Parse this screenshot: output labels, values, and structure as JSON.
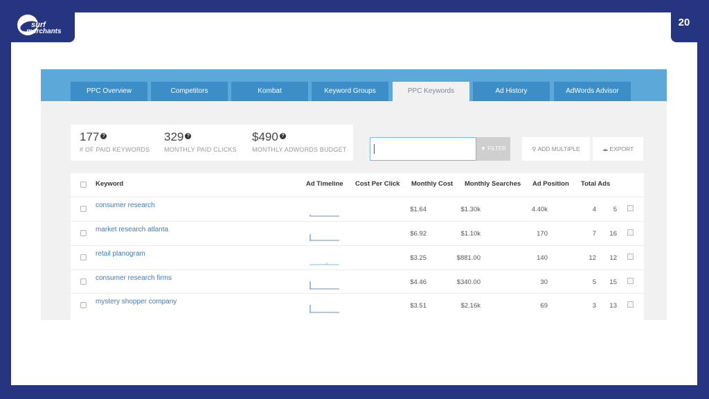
{
  "logo": {
    "line1": "surf",
    "line2": "merchants"
  },
  "page_number": "20",
  "tabs": [
    {
      "label": "PPC Overview",
      "active": false
    },
    {
      "label": "Competitors",
      "active": false
    },
    {
      "label": "Kombat",
      "active": false
    },
    {
      "label": "Keyword Groups",
      "active": false
    },
    {
      "label": "PPC Keywords",
      "active": true
    },
    {
      "label": "Ad History",
      "active": false
    },
    {
      "label": "AdWords Advisor",
      "active": false
    }
  ],
  "stats": [
    {
      "value": "177",
      "label": "# OF PAID KEYWORDS"
    },
    {
      "value": "329",
      "label": "MONTHLY PAID CLICKS"
    },
    {
      "value": "$490",
      "label": "MONTHLY ADWORDS BUDGET"
    }
  ],
  "search": {
    "value": ""
  },
  "buttons": {
    "filter": "FILTER",
    "add_multiple": "ADD MULTIPLE",
    "export": "EXPORT"
  },
  "table": {
    "headers": {
      "keyword": "Keyword",
      "ad_timeline": "Ad Timeline",
      "cpc": "Cost Per Click",
      "monthly_cost": "Monthly Cost",
      "monthly_searches": "Monthly Searches",
      "ad_position": "Ad Position",
      "total_ads": "Total Ads"
    },
    "rows": [
      {
        "keyword": "consumer research",
        "cpc": "$1.64",
        "monthly_cost": "$1.30k",
        "monthly_searches": "4.40k",
        "ad_position": "4",
        "total_ads": "5"
      },
      {
        "keyword": "market research atlanta",
        "cpc": "$6.92",
        "monthly_cost": "$1.10k",
        "monthly_searches": "170",
        "ad_position": "7",
        "total_ads": "16"
      },
      {
        "keyword": "retail planogram",
        "cpc": "$3.25",
        "monthly_cost": "$881.00",
        "monthly_searches": "140",
        "ad_position": "12",
        "total_ads": "12"
      },
      {
        "keyword": "consumer research firms",
        "cpc": "$4.46",
        "monthly_cost": "$340.00",
        "monthly_searches": "30",
        "ad_position": "5",
        "total_ads": "15"
      },
      {
        "keyword": "mystery shopper company",
        "cpc": "$3.51",
        "monthly_cost": "$2.16k",
        "monthly_searches": "69",
        "ad_position": "3",
        "total_ads": "13"
      }
    ]
  },
  "colors": {
    "frame": "#263580",
    "tabbar": "#5ca8d8",
    "tab": "#3d8ec7",
    "link": "#3b7bb8"
  }
}
